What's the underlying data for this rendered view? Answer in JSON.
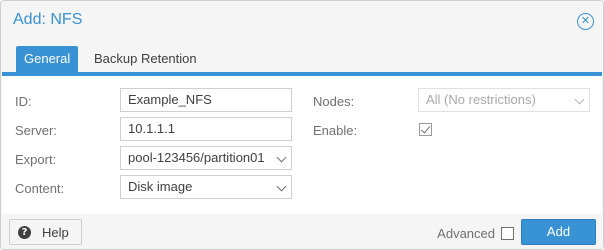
{
  "dialog": {
    "title": "Add: NFS",
    "close_icon": "close-circle-icon"
  },
  "tabs": [
    {
      "label": "General",
      "active": true
    },
    {
      "label": "Backup Retention",
      "active": false
    }
  ],
  "form": {
    "id": {
      "label": "ID:",
      "value": "Example_NFS"
    },
    "server": {
      "label": "Server:",
      "value": "10.1.1.1"
    },
    "export": {
      "label": "Export:",
      "value": "pool-123456/partition01"
    },
    "content": {
      "label": "Content:",
      "value": "Disk image"
    },
    "nodes": {
      "label": "Nodes:",
      "value": "All (No restrictions)",
      "disabled": true
    },
    "enable": {
      "label": "Enable:",
      "checked": true
    }
  },
  "footer": {
    "help_label": "Help",
    "help_icon": "question-circle-icon",
    "advanced_label": "Advanced",
    "advanced_checked": false,
    "add_label": "Add"
  },
  "colors": {
    "accent": "#3892d4",
    "background": "#f5f5f5"
  }
}
